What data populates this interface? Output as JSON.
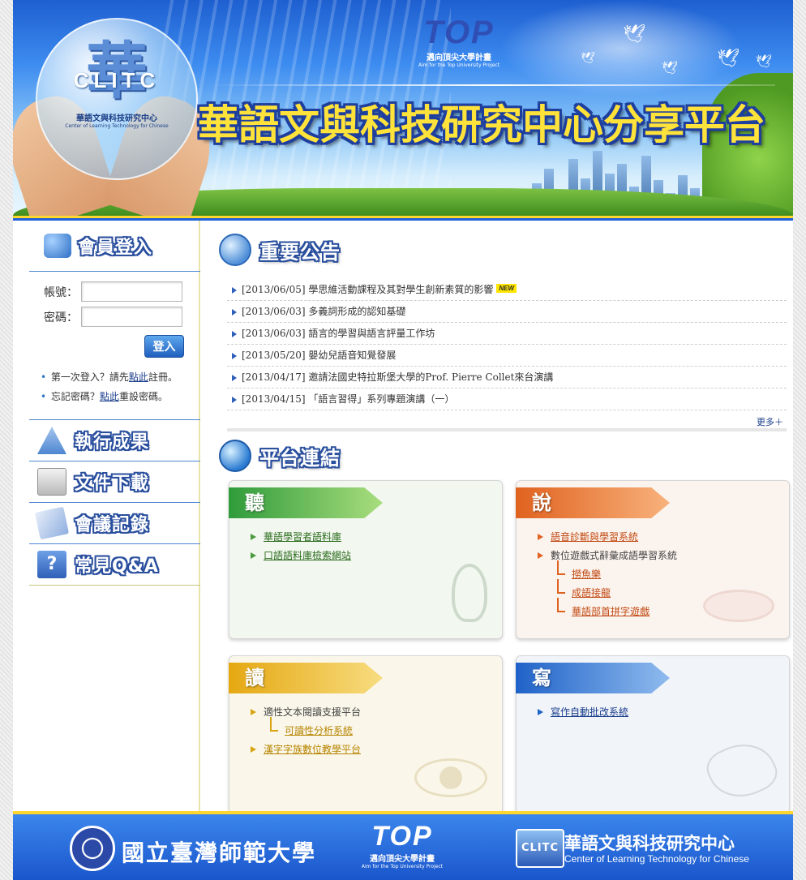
{
  "banner": {
    "title": "華語文與科技研究中心分享平台",
    "logo_char": "華",
    "logo_letters": "CLITC",
    "logo_cn": "華語文與科技研究中心",
    "logo_en": "Center of Learning Technology for Chinese",
    "top_word": "TOP",
    "top_cn": "邁向頂尖大學計畫",
    "top_en": "Aim for the Top University Project"
  },
  "sidebar": {
    "login_title": "會員登入",
    "account_label": "帳號：",
    "password_label": "密碼：",
    "account_value": "",
    "password_value": "",
    "login_button": "登入",
    "note1_prefix": "第一次登入？請先",
    "note1_link": "點此",
    "note1_suffix": "註冊。",
    "note2_prefix": "忘記密碼？",
    "note2_link": "點此",
    "note2_suffix": "重設密碼。",
    "menu": [
      {
        "label": "執行成果",
        "icon": "tree-icon"
      },
      {
        "label": "文件下載",
        "icon": "folder-download-icon"
      },
      {
        "label": "會議記錄",
        "icon": "pen-notes-icon"
      },
      {
        "label": "常見Q&A",
        "icon": "question-icon"
      }
    ]
  },
  "announcements": {
    "title": "重要公告",
    "new_badge": "NEW",
    "items": [
      "[2013/06/05] 學思維活動課程及其對學生創新素質的影響",
      "[2013/06/03] 多義詞形成的認知基礎",
      "[2013/06/03] 語言的學習與語言評量工作坊",
      "[2013/05/20] 嬰幼兒語音知覺發展",
      "[2013/04/17] 邀請法國史特拉斯堡大學的Prof. Pierre Collet來台演講",
      "[2013/04/15] 「語言習得」系列專題演講（一）"
    ],
    "more": "更多＋"
  },
  "platform": {
    "title": "平台連結",
    "listen": {
      "tab": "聽",
      "items": [
        "華語學習者語料庫",
        "口語語料庫檢索網站"
      ]
    },
    "speak": {
      "tab": "說",
      "items": [
        "語音診斷與學習系統",
        "數位遊戲式辭彙成語學習系統"
      ],
      "subitems": [
        "撈魚樂",
        "成語接龍",
        "華語部首拼字遊戲"
      ]
    },
    "read": {
      "tab": "讀",
      "item1": "適性文本閱讀支援平台",
      "sub1": "可讀性分析系統",
      "item2": "漢字字族數位教學平台"
    },
    "write": {
      "tab": "寫",
      "items": [
        "寫作自動批改系統"
      ]
    }
  },
  "footer": {
    "ntnu": "國立臺灣師範大學",
    "top_word": "TOP",
    "top_cn": "邁向頂尖大學計畫",
    "top_en": "Aim for the Top University Project",
    "center_badge": "CLITC",
    "center_cn": "華語文與科技研究中心",
    "center_en": "Center of Learning Technology for Chinese"
  },
  "colors": {
    "brand_blue": "#1e61d8",
    "accent_yellow": "#ffd62e",
    "listen_green": "#2f9b3a",
    "speak_orange": "#e0621f",
    "read_yellow": "#e5a812",
    "write_blue": "#1f62c8"
  }
}
